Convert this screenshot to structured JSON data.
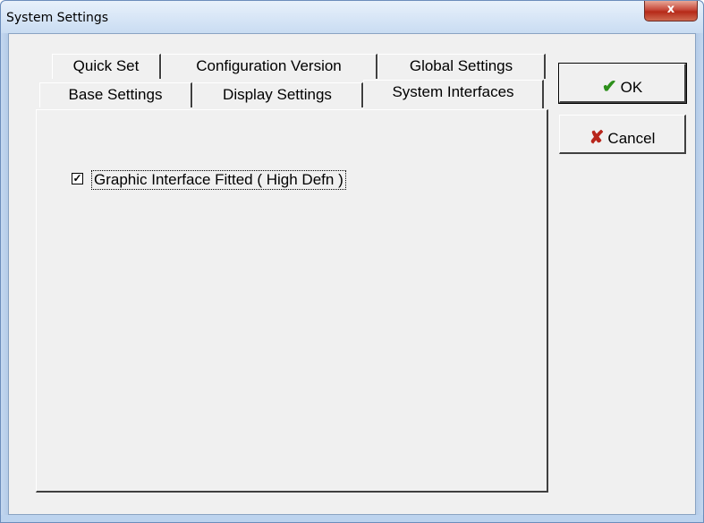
{
  "window": {
    "title": "System Settings",
    "close_label": "x"
  },
  "tabs": {
    "row_back": [
      "Quick Set",
      "Configuration Version",
      "Global Settings"
    ],
    "row_front": [
      "Base Settings",
      "Display Settings",
      "System Interfaces"
    ],
    "active": "System Interfaces"
  },
  "panel": {
    "checkbox": {
      "label": "Graphic Interface Fitted ( High Defn )",
      "checked": true,
      "mark": "✓"
    }
  },
  "buttons": {
    "ok": {
      "label": "OK",
      "icon": "checkmark-icon"
    },
    "cancel": {
      "label": "Cancel",
      "icon": "x-icon"
    }
  },
  "colors": {
    "ok_icon": "#2c8f1a",
    "cancel_icon": "#b8261c"
  }
}
